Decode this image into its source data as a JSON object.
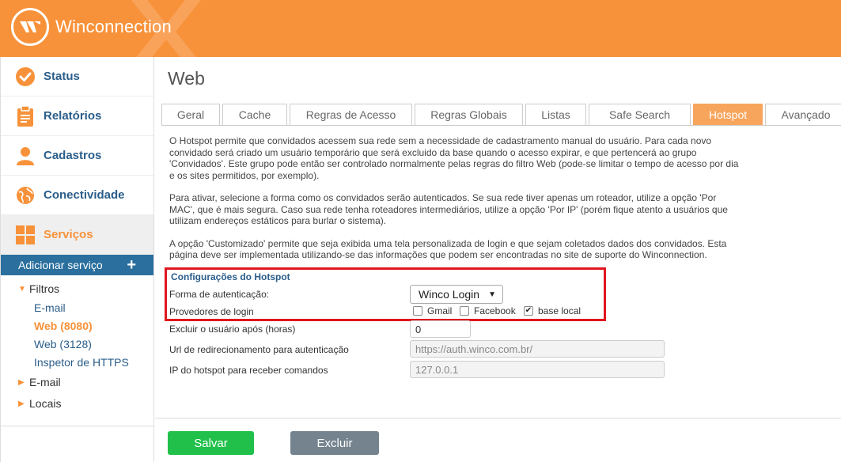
{
  "header": {
    "brand": "Winconnection"
  },
  "sidebar": {
    "menu": [
      {
        "label": "Status",
        "icon": "check-circle-icon"
      },
      {
        "label": "Relatórios",
        "icon": "clipboard-icon"
      },
      {
        "label": "Cadastros",
        "icon": "user-icon"
      },
      {
        "label": "Conectividade",
        "icon": "globe-icon"
      },
      {
        "label": "Serviços",
        "icon": "grid-icon"
      }
    ],
    "add_service": "Adicionar serviço",
    "tree": {
      "filtros": "Filtros",
      "leaves": [
        "E-mail",
        "Web (8080)",
        "Web (3128)",
        "Inspetor de HTTPS"
      ],
      "email": "E-mail",
      "locais": "Locais"
    }
  },
  "main": {
    "title": "Web",
    "tabs": [
      "Geral",
      "Cache",
      "Regras de Acesso",
      "Regras Globais",
      "Listas",
      "Safe Search",
      "Hotspot",
      "Avançado"
    ],
    "active_tab": "Hotspot",
    "description": [
      "O Hotspot permite que convidados acessem sua rede sem a necessidade de cadastramento manual do usuário. Para cada novo convidado será criado um usuário temporário que será excluido da base quando o acesso expirar, e que pertencerá ao grupo 'Convidados'. Este grupo pode então ser controlado normalmente pelas regras do filtro Web (pode-se limitar o tempo de acesso por dia e os sites permitidos, por exemplo).",
      "Para ativar, selecione a forma como os convidados serão autenticados. Se sua rede tiver apenas um roteador, utilize a opção 'Por MAC', que é mais segura. Caso sua rede tenha roteadores intermediários, utilize a opção 'Por IP' (porém fique atento a usuários que utilizam endereços estáticos para burlar o sistema).",
      "A opção 'Customizado' permite que seja exibida uma tela personalizada de login e que sejam coletados dados dos convidados. Esta página deve ser implementada utilizando-se das informações que podem ser encontradas no site de suporte do Winconnection."
    ],
    "config": {
      "title": "Configurações do Hotspot",
      "auth_label": "Forma de autenticação:",
      "auth_value": "Winco Login",
      "providers_label": "Provedores de login",
      "providers": [
        {
          "label": "Gmail",
          "checked": false
        },
        {
          "label": "Facebook",
          "checked": false
        },
        {
          "label": "base local",
          "checked": true
        }
      ],
      "delete_after_label": "Excluir o usuário após (horas)",
      "delete_after_value": "0",
      "redirect_label": "Url de redirecionamento para autenticação",
      "redirect_placeholder": "https://auth.winco.com.br/",
      "ip_label": "IP do hotspot para receber comandos",
      "ip_placeholder": "127.0.0.1"
    },
    "buttons": {
      "save": "Salvar",
      "delete": "Excluir"
    }
  },
  "colors": {
    "brand_orange": "#f7923a",
    "link_blue": "#2a5d8a",
    "highlight_red": "#e0161f",
    "save_green": "#20c04a"
  }
}
